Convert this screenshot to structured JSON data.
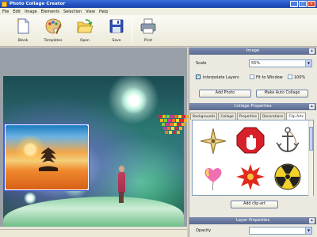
{
  "window": {
    "title": "Photo Collage Creator"
  },
  "menu": [
    "File",
    "Edit",
    "Image",
    "Elements",
    "Selection",
    "View",
    "Help"
  ],
  "toolbar": [
    {
      "label": "Blank",
      "icon": "blank-page-icon"
    },
    {
      "label": "Templates",
      "icon": "palette-icon"
    },
    {
      "label": "Open",
      "icon": "folder-open-icon"
    },
    {
      "label": "Save",
      "icon": "floppy-disk-icon"
    },
    {
      "label": "Print",
      "icon": "printer-icon"
    }
  ],
  "image_panel": {
    "header": "Image",
    "scale_label": "Scale",
    "scale_value": "55%",
    "interpolate_label": "Interpolate Layers",
    "fit_label": "Fit to Window",
    "zoom_label": "100%",
    "add_photo": "Add Photo",
    "auto_collage": "Make Auto Collage"
  },
  "collage_panel": {
    "header": "Collage Properties",
    "tabs": [
      "Backgrounds",
      "Collage",
      "Properties",
      "Decorations",
      "Clip Arts"
    ],
    "active_tab": 4,
    "cliparts": [
      "compass-flower-clipart",
      "stop-hand-sign-clipart",
      "anchor-clipart",
      "heart-balloon-clipart",
      "red-star-burst-clipart",
      "radiation-sign-clipart"
    ],
    "add_button": "Add clip-art"
  },
  "layer_panel": {
    "header": "Layer Properties",
    "opacity_label": "Opacity"
  },
  "colors": {
    "accent": "#3b5bd9",
    "header": "#6a7aa0"
  }
}
